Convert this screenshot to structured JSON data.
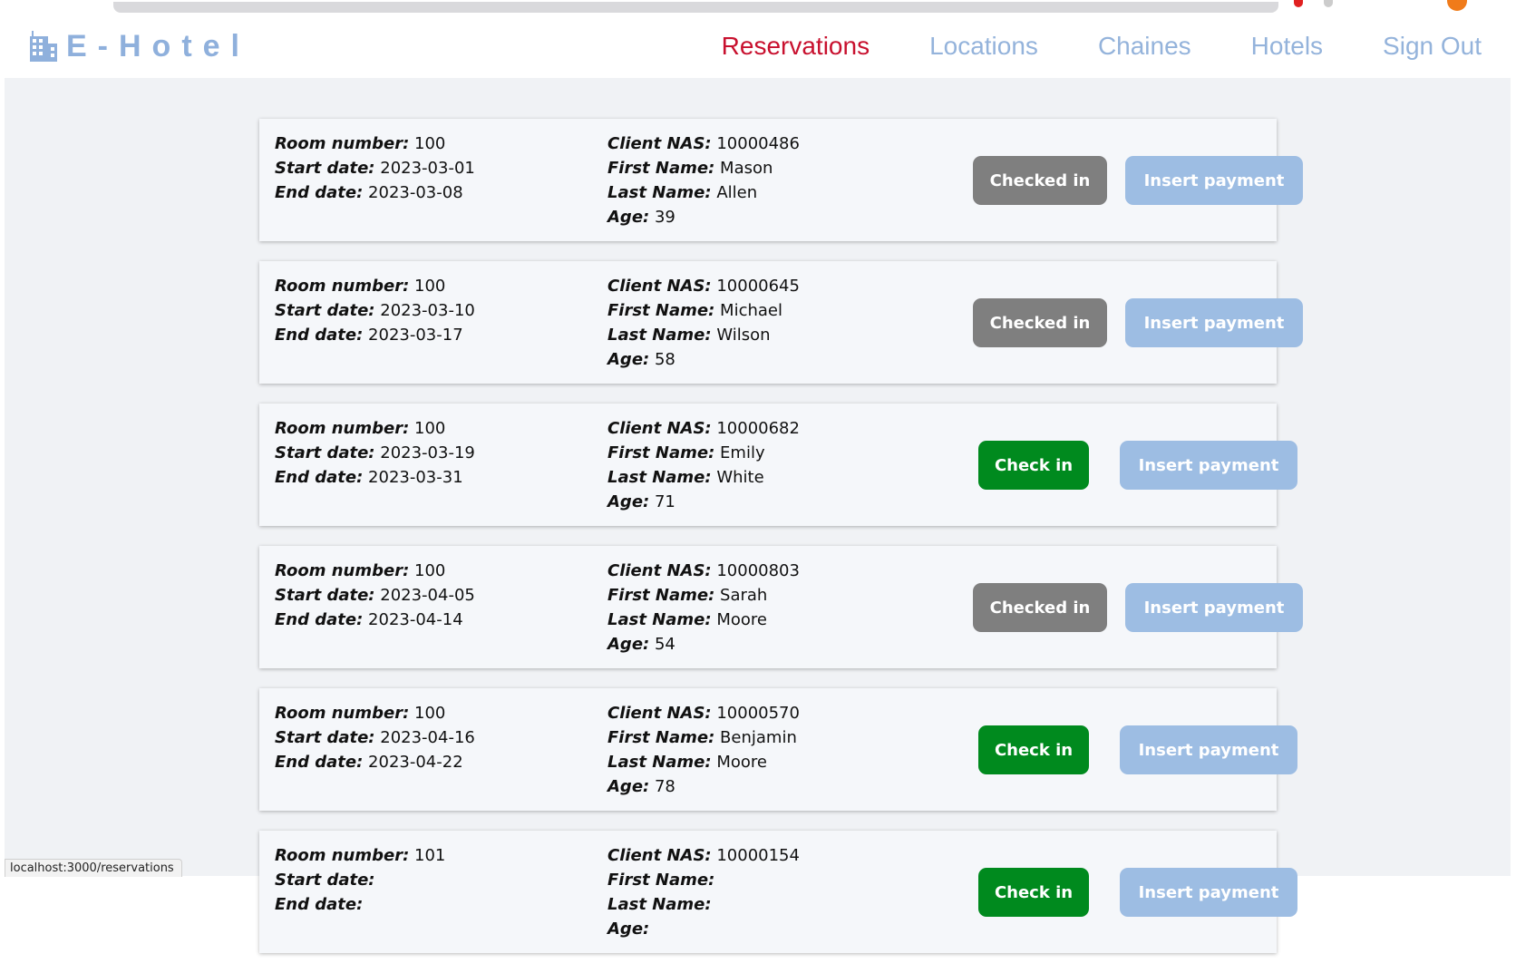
{
  "brand": {
    "name": "E-Hotel",
    "icon": "building-icon",
    "color": "#8fb0dc"
  },
  "nav": {
    "items": [
      {
        "label": "Reservations",
        "active": true
      },
      {
        "label": "Locations",
        "active": false
      },
      {
        "label": "Chaines",
        "active": false
      },
      {
        "label": "Hotels",
        "active": false
      },
      {
        "label": "Sign Out",
        "active": false
      }
    ],
    "active_color": "#c8102e",
    "inactive_color": "#94b3db"
  },
  "labels": {
    "room_number": "Room number:",
    "start_date": "Start date:",
    "end_date": "End date:",
    "client_nas": "Client NAS:",
    "first_name": "First Name:",
    "last_name": "Last Name:",
    "age": "Age:",
    "checked_in": "Checked in",
    "check_in": "Check in",
    "insert_payment": "Insert payment"
  },
  "colors": {
    "checked_in_button": "#7f7f7f",
    "check_in_button": "#008a1e",
    "insert_payment_button": "#9dbde3"
  },
  "reservations": [
    {
      "room_number": "100",
      "start_date": "2023-03-01",
      "end_date": "2023-03-08",
      "client_nas": "10000486",
      "first_name": "Mason",
      "last_name": "Allen",
      "age": "39",
      "checked_in": true
    },
    {
      "room_number": "100",
      "start_date": "2023-03-10",
      "end_date": "2023-03-17",
      "client_nas": "10000645",
      "first_name": "Michael",
      "last_name": "Wilson",
      "age": "58",
      "checked_in": true
    },
    {
      "room_number": "100",
      "start_date": "2023-03-19",
      "end_date": "2023-03-31",
      "client_nas": "10000682",
      "first_name": "Emily",
      "last_name": "White",
      "age": "71",
      "checked_in": false
    },
    {
      "room_number": "100",
      "start_date": "2023-04-05",
      "end_date": "2023-04-14",
      "client_nas": "10000803",
      "first_name": "Sarah",
      "last_name": "Moore",
      "age": "54",
      "checked_in": true
    },
    {
      "room_number": "100",
      "start_date": "2023-04-16",
      "end_date": "2023-04-22",
      "client_nas": "10000570",
      "first_name": "Benjamin",
      "last_name": "Moore",
      "age": "78",
      "checked_in": false
    },
    {
      "room_number": "101",
      "start_date": "",
      "end_date": "",
      "client_nas": "10000154",
      "first_name": "",
      "last_name": "",
      "age": "",
      "checked_in": false
    }
  ],
  "status_bar": {
    "url": "localhost:3000/reservations"
  }
}
